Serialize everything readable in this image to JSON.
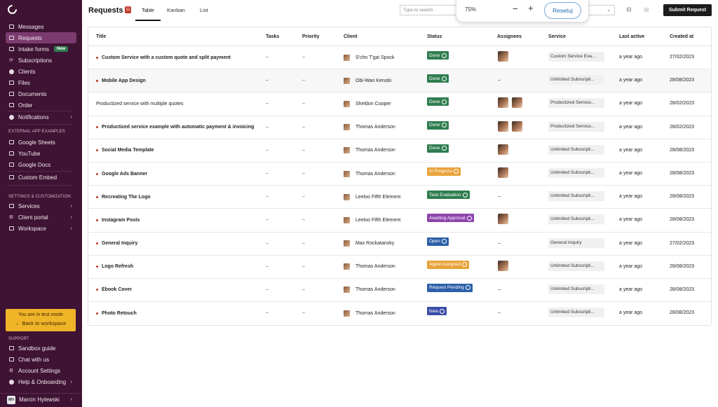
{
  "sidebar": {
    "items": [
      {
        "label": "Messages",
        "icon": "chat-icon"
      },
      {
        "label": "Requests",
        "icon": "inbox-icon",
        "active": true
      },
      {
        "label": "Intake forms",
        "icon": "form-icon",
        "badge": "New"
      },
      {
        "label": "Subscriptions",
        "icon": "refresh-icon"
      },
      {
        "label": "Clients",
        "icon": "user-icon"
      },
      {
        "label": "Files",
        "icon": "folder-icon"
      },
      {
        "label": "Documents",
        "icon": "document-icon"
      },
      {
        "label": "Order",
        "icon": "cart-icon"
      },
      {
        "label": "Notifications",
        "icon": "bell-icon",
        "chevron": true
      }
    ],
    "external_section_label": "EXTERNAL APP EXAMPLES",
    "external_items": [
      {
        "label": "Google Sheets"
      },
      {
        "label": "YouTube"
      },
      {
        "label": "Google Docs"
      },
      {
        "label": "Custom Embed"
      }
    ],
    "settings_section_label": "SETTINGS & CUSTOMIZATION",
    "settings_items": [
      {
        "label": "Services"
      },
      {
        "label": "Client portal"
      },
      {
        "label": "Workspace"
      }
    ],
    "test_mode": {
      "line1": "You are in test mode",
      "line2": "← Back to workspace"
    },
    "support_section_label": "SUPPORT",
    "support_items": [
      {
        "label": "Sandbox guide"
      },
      {
        "label": "Chat with us"
      },
      {
        "label": "Account Settings"
      },
      {
        "label": "Help & Onboarding"
      }
    ],
    "user": {
      "name": "Marcin Hylewski",
      "initials": "MH"
    }
  },
  "header": {
    "title": "Requests",
    "count": "11",
    "tabs": [
      "Table",
      "Kanban",
      "List"
    ],
    "search_placeholder": "Type to search",
    "submit_label": "Submit Request"
  },
  "zoom": {
    "level": "75%",
    "minus": "−",
    "plus": "+",
    "reset_label": "Resetuj"
  },
  "table": {
    "columns": [
      "Title",
      "Tasks",
      "Priority",
      "Client",
      "Status",
      "Assignees",
      "Service",
      "Last active",
      "Created at"
    ],
    "rows": [
      {
        "title": "Custom Service with a custom quote and split payment",
        "unread": true,
        "tasks": "–",
        "priority": "–",
        "client": "S'chn T'gai Spock",
        "status": "Done",
        "status_color": "#2f7d4f",
        "assignees": 1,
        "service": "Custom Service Exa...",
        "last_active": "a year ago",
        "created": "27/02/2023"
      },
      {
        "title": "Mobile App Design",
        "unread": true,
        "tasks": "–",
        "priority": "–",
        "client": "Obi-Wan Kenobi",
        "status": "Done",
        "status_color": "#2f7d4f",
        "assignees": 0,
        "service": "Unlimited Subscripti...",
        "last_active": "a year ago",
        "created": "28/08/2023"
      },
      {
        "title": "Productized service with multiple quotes",
        "unread": false,
        "tasks": "–",
        "priority": "–",
        "client": "Sheldon Cooper",
        "status": "Done",
        "status_color": "#2f7d4f",
        "assignees": 2,
        "service": "Productized Service...",
        "last_active": "a year ago",
        "created": "28/02/2023"
      },
      {
        "title": "Productized service example with automatic payment & invoicing",
        "unread": true,
        "tasks": "–",
        "priority": "–",
        "client": "Thomas Anderson",
        "status": "Done",
        "status_color": "#2f7d4f",
        "assignees": 2,
        "service": "Productized Service...",
        "last_active": "a year ago",
        "created": "28/02/2023"
      },
      {
        "title": "Social Media Template",
        "unread": true,
        "tasks": "–",
        "priority": "–",
        "client": "Thomas Anderson",
        "status": "Done",
        "status_color": "#2f7d4f",
        "assignees": 1,
        "service": "Unlimited Subscripti...",
        "last_active": "a year ago",
        "created": "28/08/2023"
      },
      {
        "title": "Google Ads Banner",
        "unread": true,
        "tasks": "–",
        "priority": "–",
        "client": "Thomas Anderson",
        "status": "In Progress",
        "status_color": "#e8a33a",
        "assignees": 1,
        "service": "Unlimited Subscripti...",
        "last_active": "a year ago",
        "created": "28/08/2023"
      },
      {
        "title": "Recreating The Logo",
        "unread": true,
        "tasks": "–",
        "priority": "–",
        "client": "Leeloo Fifth Element",
        "status": "Task Evaluation",
        "status_color": "#2f7d4f",
        "assignees": 0,
        "service": "Unlimited Subscripti...",
        "last_active": "a year ago",
        "created": "28/08/2023"
      },
      {
        "title": "Instagram Posts",
        "unread": true,
        "tasks": "–",
        "priority": "–",
        "client": "Leeloo Fifth Element",
        "status": "Awaiting Approval",
        "status_color": "#8e44ad",
        "assignees": 1,
        "service": "Unlimited Subscripti...",
        "last_active": "a year ago",
        "created": "28/08/2023"
      },
      {
        "title": "General Inquiry",
        "unread": true,
        "tasks": "–",
        "priority": "–",
        "client": "Max Rockatansky",
        "status": "Open",
        "status_color": "#2c5fa8",
        "assignees": 0,
        "service": "General Inquiry",
        "last_active": "a year ago",
        "created": "27/02/2023"
      },
      {
        "title": "Logo Refresh",
        "unread": true,
        "tasks": "–",
        "priority": "–",
        "client": "Thomas Anderson",
        "status": "Agent Assigned",
        "status_color": "#e8a33a",
        "assignees": 1,
        "service": "Unlimited Subscripti...",
        "last_active": "a year ago",
        "created": "28/08/2023"
      },
      {
        "title": "Ebook Cover",
        "unread": true,
        "tasks": "–",
        "priority": "–",
        "client": "Thomas Anderson",
        "status": "Request Pending",
        "status_color": "#2c5fa8",
        "assignees": 0,
        "service": "Unlimited Subscripti...",
        "last_active": "a year ago",
        "created": "28/08/2023"
      },
      {
        "title": "Photo Retouch",
        "unread": true,
        "tasks": "–",
        "priority": "–",
        "client": "Thomas Anderson",
        "status": "New",
        "status_color": "#3a4ea8",
        "assignees": 0,
        "service": "Unlimited Subscripti...",
        "last_active": "a year ago",
        "created": "28/08/2023"
      }
    ],
    "empty_assignee": "–"
  }
}
